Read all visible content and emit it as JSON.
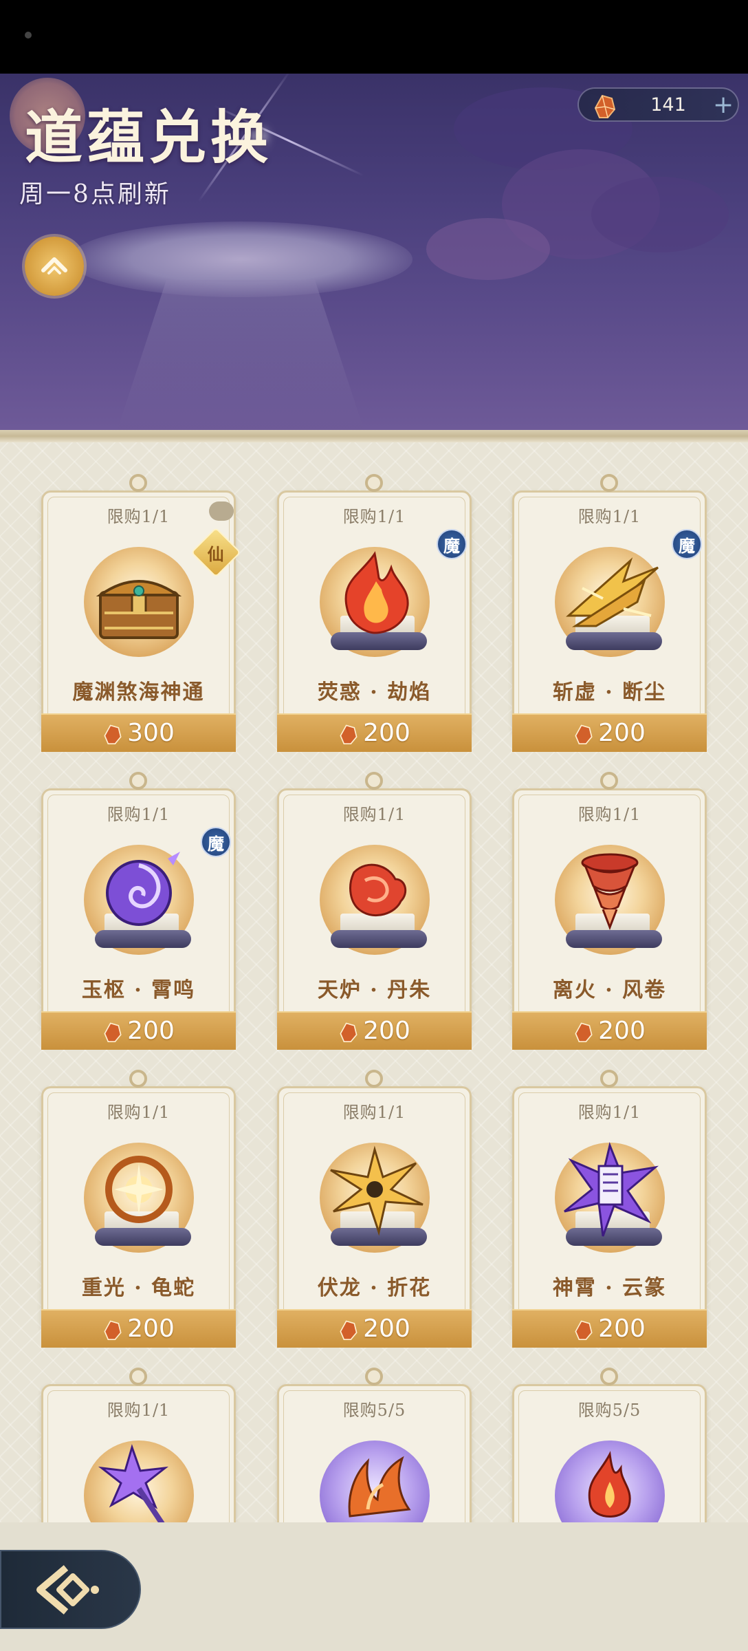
{
  "header": {
    "title": "道蕴兑换",
    "refresh_note": "周一8点刷新",
    "currency_amount": "141",
    "add_label": "+"
  },
  "colors": {
    "accent_gold": "#c9913c",
    "item_name": "#8a5a2b",
    "banner_purple": "#4a3f7c"
  },
  "items": [
    {
      "limit": "限购1/1",
      "name": "魔渊煞海神通",
      "price": "300",
      "badge": "仙",
      "icon": "treasure-chest-icon"
    },
    {
      "limit": "限购1/1",
      "name": "荧惑 · 劫焰",
      "price": "200",
      "badge": "魔",
      "icon": "flame-skill-icon"
    },
    {
      "limit": "限购1/1",
      "name": "斩虚 · 断尘",
      "price": "200",
      "badge": "魔",
      "icon": "golden-blades-icon"
    },
    {
      "limit": "限购1/1",
      "name": "玉枢 · 霄鸣",
      "price": "200",
      "badge": "魔",
      "icon": "purple-vortex-icon"
    },
    {
      "limit": "限购1/1",
      "name": "天炉 · 丹朱",
      "price": "200",
      "badge": "",
      "icon": "red-flame-hand-icon"
    },
    {
      "limit": "限购1/1",
      "name": "离火 · 风卷",
      "price": "200",
      "badge": "",
      "icon": "fire-tornado-icon"
    },
    {
      "limit": "限购1/1",
      "name": "重光 · 龟蛇",
      "price": "200",
      "badge": "",
      "icon": "sun-ring-icon"
    },
    {
      "limit": "限购1/1",
      "name": "伏龙 · 折花",
      "price": "200",
      "badge": "",
      "icon": "lightning-burst-icon"
    },
    {
      "limit": "限购1/1",
      "name": "神霄 · 云篆",
      "price": "200",
      "badge": "",
      "icon": "purple-talisman-icon"
    },
    {
      "limit": "限购1/1",
      "name": "",
      "price": "",
      "badge": "",
      "icon": "purple-star-staff-icon"
    },
    {
      "limit": "限购5/5",
      "name": "",
      "price": "",
      "badge": "",
      "icon": "flame-claw-icon"
    },
    {
      "limit": "限购5/5",
      "name": "",
      "price": "",
      "badge": "",
      "icon": "fire-spirit-icon"
    }
  ]
}
